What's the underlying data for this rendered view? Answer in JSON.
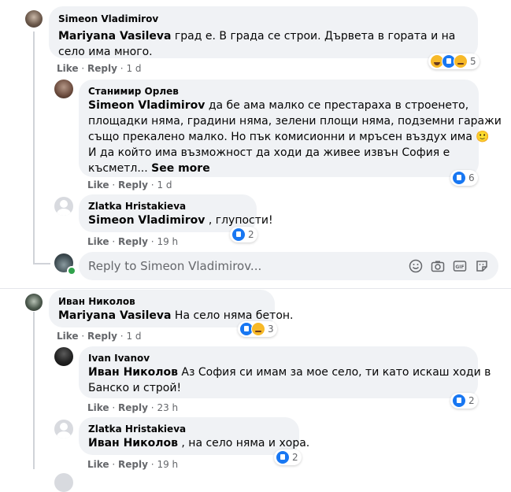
{
  "comments": [
    {
      "author": "Simeon Vladimirov",
      "mention": "Mariyana Vasileva",
      "text": " град е. В града се строи. Дървета в гората и на село има много.",
      "actions": {
        "like": "Like",
        "reply": "Reply",
        "time": "1 d"
      },
      "reactions": {
        "count": "5",
        "icons": [
          "haha",
          "like",
          "sad"
        ]
      },
      "replies": [
        {
          "author": "Станимир Орлев",
          "mention": "Simeon Vladimirov",
          "text_lines": [
            " да бе ама малко се престараха в строенето,",
            "площадки няма, градини няма, зелени площи няма, подземни гаражи",
            "също прекалено малко. Но пък комисионни и мръсен въздух има 🙂",
            "И да който има възможност да ходи да живее извън София е",
            "късметл..."
          ],
          "see_more": "See more",
          "actions": {
            "like": "Like",
            "reply": "Reply",
            "time": "1 d"
          },
          "reactions": {
            "count": "6",
            "icons": [
              "like"
            ]
          }
        },
        {
          "author": "Zlatka Hristakieva",
          "mention": "Simeon Vladimirov",
          "text": " , глупости!",
          "actions": {
            "like": "Like",
            "reply": "Reply",
            "time": "19 h"
          },
          "reactions": {
            "count": "2",
            "icons": [
              "like"
            ]
          }
        }
      ],
      "reply_placeholder": "Reply to Simeon Vladimirov..."
    },
    {
      "author": "Иван Николов",
      "mention": "Mariyana Vasileva",
      "text": " На село няма бетон.",
      "actions": {
        "like": "Like",
        "reply": "Reply",
        "time": "1 d"
      },
      "reactions": {
        "count": "3",
        "icons": [
          "like",
          "sad"
        ]
      },
      "replies": [
        {
          "author": "Ivan Ivanov",
          "mention": "Иван Николов",
          "text_lines": [
            " Аз София си имам за мое село, ти като искаш ходи в",
            "Банско и строй!"
          ],
          "actions": {
            "like": "Like",
            "reply": "Reply",
            "time": "23 h"
          },
          "reactions": {
            "count": "2",
            "icons": [
              "like"
            ]
          }
        },
        {
          "author": "Zlatka Hristakieva",
          "mention": "Иван Николов",
          "text": " , на село няма и хора.",
          "actions": {
            "like": "Like",
            "reply": "Reply",
            "time": "19 h"
          },
          "reactions": {
            "count": "2",
            "icons": [
              "like"
            ]
          }
        }
      ]
    }
  ],
  "separator": "·",
  "colors": {
    "bubble": "#f0f2f5",
    "meta": "#65676b",
    "like_blue": "#1877f2",
    "haha_yellow": "#f7b928",
    "online_green": "#31a24c"
  },
  "icons": [
    "emoji-icon",
    "camera-icon",
    "gif-icon",
    "sticker-icon"
  ]
}
